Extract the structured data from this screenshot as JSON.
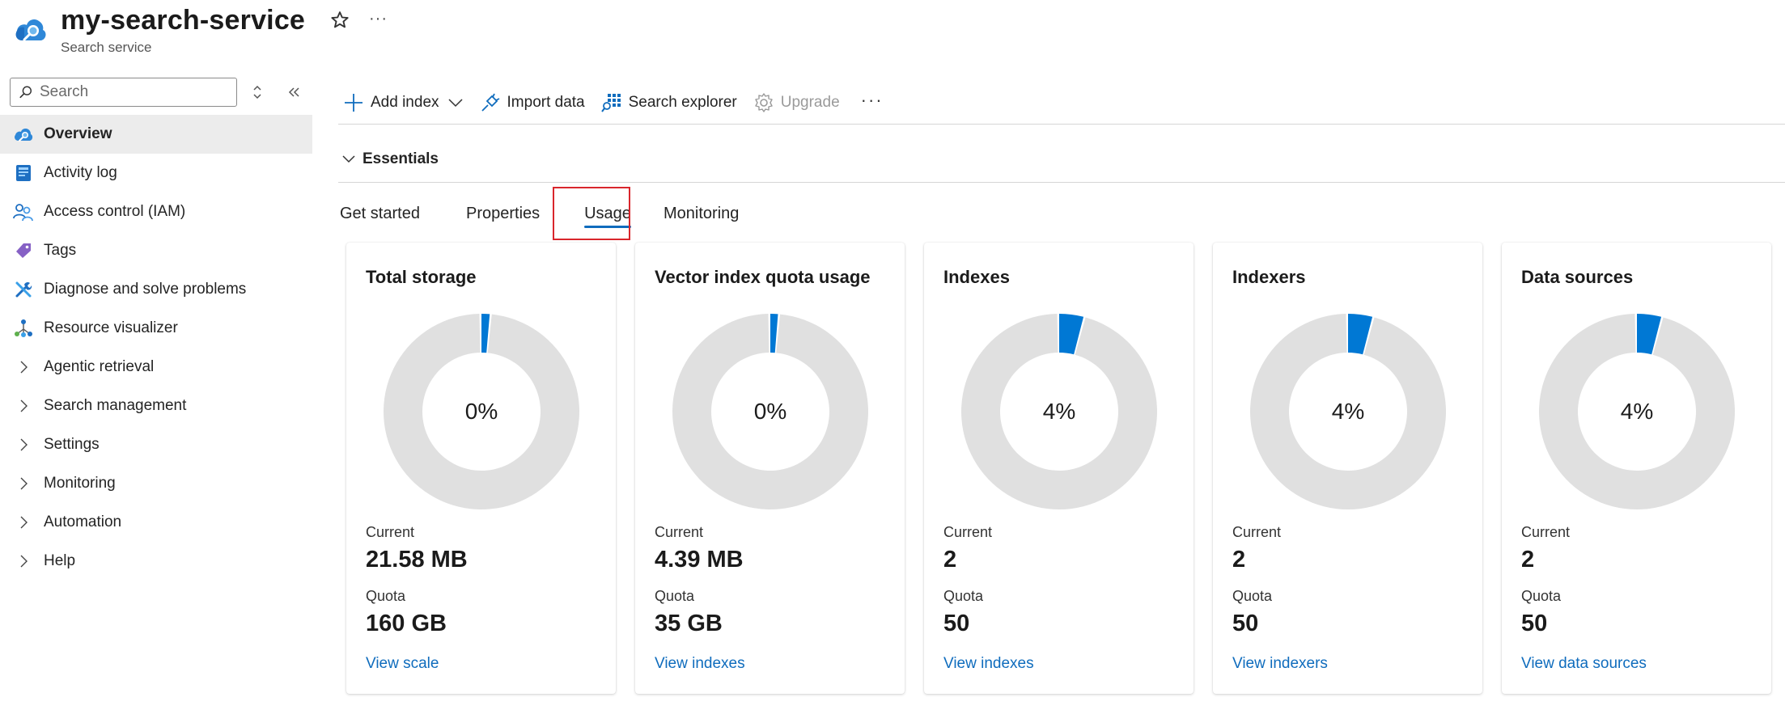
{
  "header": {
    "title": "my-search-service",
    "subtitle": "Search service"
  },
  "sidebar": {
    "search_placeholder": "Search",
    "items": [
      {
        "label": "Overview",
        "icon": "search-cloud-icon",
        "active": true
      },
      {
        "label": "Activity log",
        "icon": "activity-log-icon"
      },
      {
        "label": "Access control (IAM)",
        "icon": "people-icon"
      },
      {
        "label": "Tags",
        "icon": "tag-icon"
      },
      {
        "label": "Diagnose and solve problems",
        "icon": "wrench-icon"
      },
      {
        "label": "Resource visualizer",
        "icon": "network-icon"
      },
      {
        "label": "Agentic retrieval",
        "icon": "chevron-right-icon"
      },
      {
        "label": "Search management",
        "icon": "chevron-right-icon"
      },
      {
        "label": "Settings",
        "icon": "chevron-right-icon"
      },
      {
        "label": "Monitoring",
        "icon": "chevron-right-icon"
      },
      {
        "label": "Automation",
        "icon": "chevron-right-icon"
      },
      {
        "label": "Help",
        "icon": "chevron-right-icon"
      }
    ]
  },
  "toolbar": {
    "add_index": "Add index",
    "import_data": "Import data",
    "search_explorer": "Search explorer",
    "upgrade": "Upgrade"
  },
  "essentials": {
    "label": "Essentials"
  },
  "tabs": [
    {
      "label": "Get started"
    },
    {
      "label": "Properties"
    },
    {
      "label": "Usage",
      "selected": true
    },
    {
      "label": "Monitoring"
    }
  ],
  "colors": {
    "accent": "#0f6cbd",
    "donut_fill": "#0078d4",
    "donut_track": "#e0e0e0",
    "highlight": "#d9262c"
  },
  "cards": [
    {
      "title": "Total storage",
      "percent_label": "0%",
      "fraction": 0.0135,
      "current_label": "Current",
      "current": "21.58 MB",
      "quota_label": "Quota",
      "quota": "160 GB",
      "link": "View scale"
    },
    {
      "title": "Vector index quota usage",
      "percent_label": "0%",
      "fraction": 0.0125,
      "current_label": "Current",
      "current": "4.39 MB",
      "quota_label": "Quota",
      "quota": "35 GB",
      "link": "View indexes"
    },
    {
      "title": "Indexes",
      "percent_label": "4%",
      "fraction": 0.04,
      "current_label": "Current",
      "current": "2",
      "quota_label": "Quota",
      "quota": "50",
      "link": "View indexes"
    },
    {
      "title": "Indexers",
      "percent_label": "4%",
      "fraction": 0.04,
      "current_label": "Current",
      "current": "2",
      "quota_label": "Quota",
      "quota": "50",
      "link": "View indexers"
    },
    {
      "title": "Data sources",
      "percent_label": "4%",
      "fraction": 0.04,
      "current_label": "Current",
      "current": "2",
      "quota_label": "Quota",
      "quota": "50",
      "link": "View data sources"
    }
  ]
}
